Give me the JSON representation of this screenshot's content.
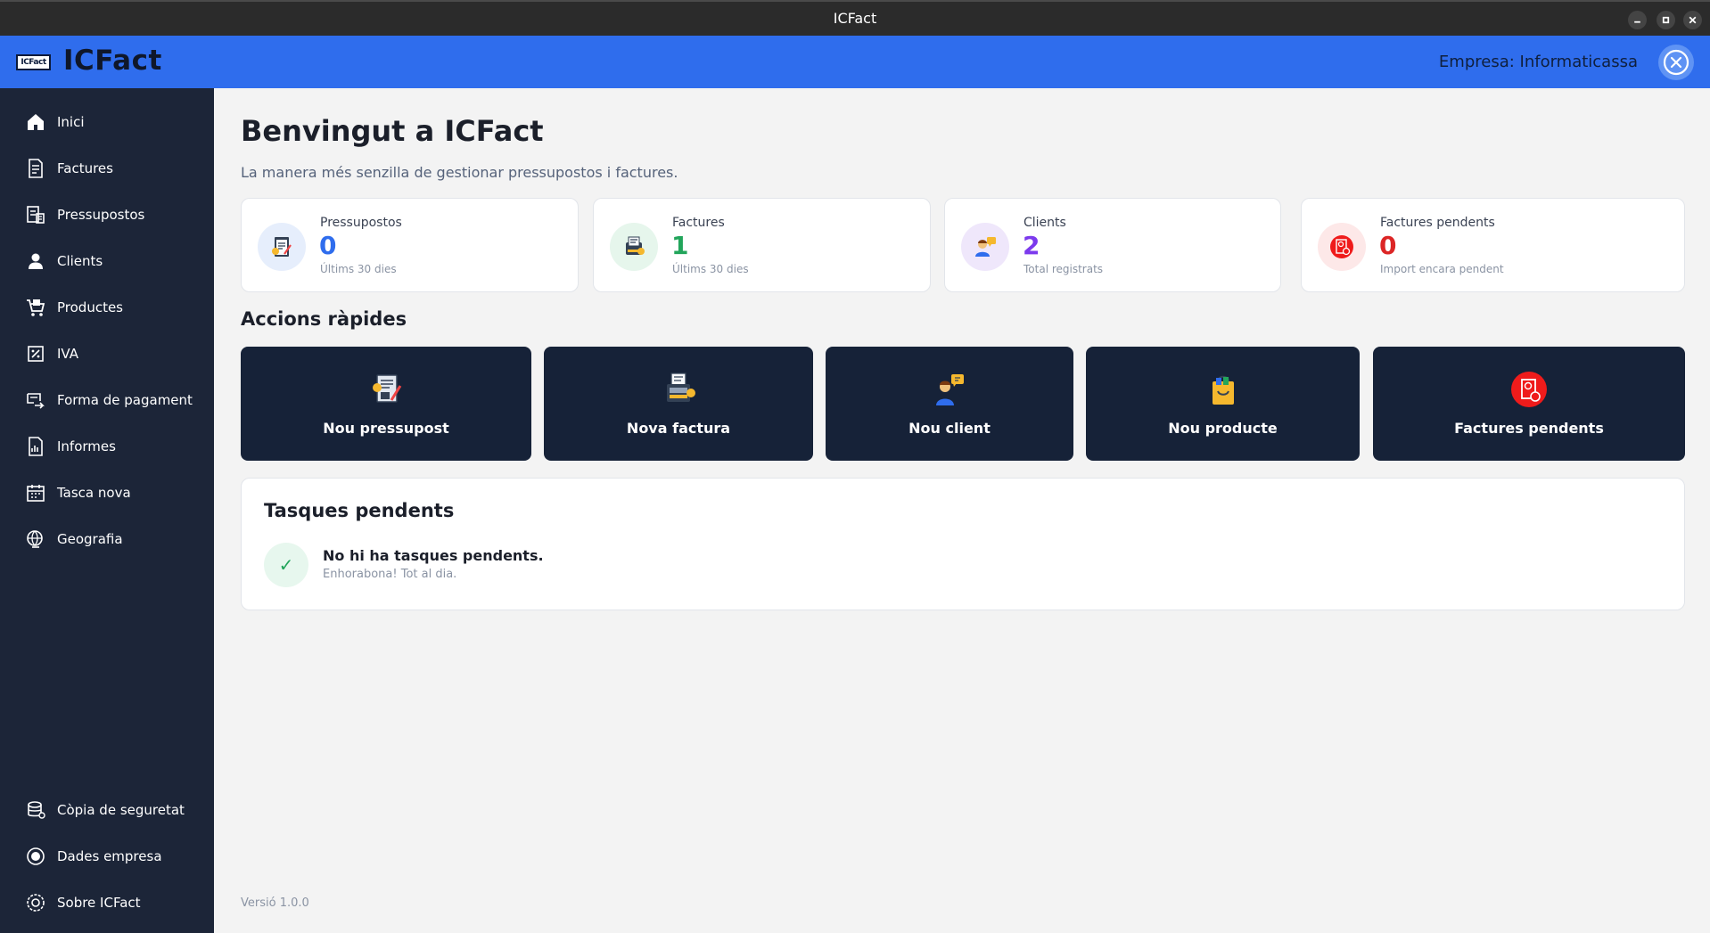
{
  "window": {
    "title": "ICFact"
  },
  "header": {
    "logo_text": "ICFact",
    "app_name": "ICFact",
    "company": "Empresa: Informaticassa"
  },
  "sidebar": {
    "items": [
      {
        "label": "Inici",
        "icon": "home-icon"
      },
      {
        "label": "Factures",
        "icon": "invoice-icon"
      },
      {
        "label": "Pressupostos",
        "icon": "budget-icon"
      },
      {
        "label": "Clients",
        "icon": "user-icon"
      },
      {
        "label": "Productes",
        "icon": "cart-icon"
      },
      {
        "label": "IVA",
        "icon": "tax-icon"
      },
      {
        "label": "Forma de pagament",
        "icon": "payment-icon"
      },
      {
        "label": "Informes",
        "icon": "report-icon"
      },
      {
        "label": "Tasca nova",
        "icon": "calendar-icon"
      },
      {
        "label": "Geografia",
        "icon": "globe-icon"
      }
    ],
    "bottom_items": [
      {
        "label": "Còpia de seguretat",
        "icon": "backup-icon"
      },
      {
        "label": "Dades empresa",
        "icon": "company-icon"
      },
      {
        "label": "Sobre ICFact",
        "icon": "info-icon"
      }
    ]
  },
  "main": {
    "title": "Benvingut a ICFact",
    "subtitle": "La manera més senzilla de gestionar pressupostos i factures.",
    "stats": [
      {
        "label": "Pressupostos",
        "value": "0",
        "sub": "Últims 30 dies",
        "color": "#2f6ded",
        "icon": "budget-doc-icon"
      },
      {
        "label": "Factures",
        "value": "1",
        "sub": "Últims 30 dies",
        "color": "#22a55b",
        "icon": "invoice-machine-icon"
      },
      {
        "label": "Clients",
        "value": "2",
        "sub": "Total registrats",
        "color": "#7c3aed",
        "icon": "client-icon"
      },
      {
        "label": "Factures pendents",
        "value": "0",
        "sub": "Import encara pendent",
        "color": "#dc2626",
        "icon": "pending-invoice-icon"
      }
    ],
    "quick_actions_title": "Accions ràpides",
    "quick_actions": [
      {
        "label": "Nou pressupost",
        "icon": "new-budget-icon"
      },
      {
        "label": "Nova factura",
        "icon": "new-invoice-icon"
      },
      {
        "label": "Nou client",
        "icon": "new-client-icon"
      },
      {
        "label": "Nou producte",
        "icon": "new-product-icon"
      },
      {
        "label": "Factures pendents",
        "icon": "pending-invoices-icon"
      }
    ],
    "tasks": {
      "title": "Tasques pendents",
      "message": "No hi ha tasques pendents.",
      "sub": "Enhorabona! Tot al dia."
    },
    "version": "Versió 1.0.0"
  }
}
